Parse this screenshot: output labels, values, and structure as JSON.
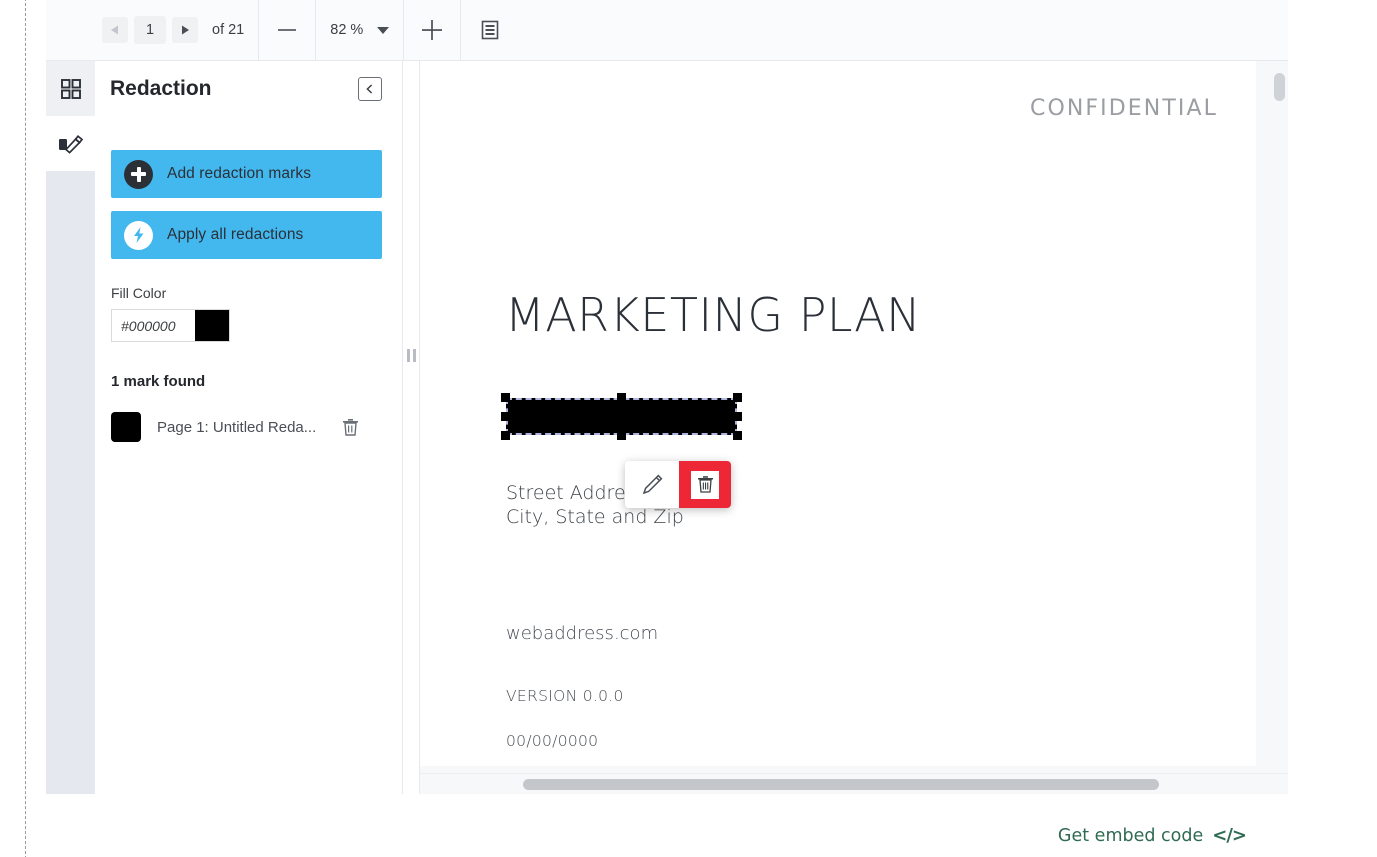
{
  "toolbar": {
    "prev_page_icon": "triangle-left-icon",
    "next_page_icon": "triangle-right-icon",
    "page_number": "1",
    "page_total_label": "of 21",
    "zoom_out_icon": "minus-icon",
    "zoom_level": "82 %",
    "zoom_dropdown_icon": "chevron-down-icon",
    "zoom_in_icon": "plus-icon",
    "page_layout_icon": "page-layout-icon"
  },
  "rail": {
    "items": [
      {
        "name": "thumbnails",
        "icon": "grid-icon"
      },
      {
        "name": "redaction",
        "icon": "pen-redact-icon"
      }
    ]
  },
  "panel": {
    "title": "Redaction",
    "collapse_icon": "chevron-left-icon",
    "add_marks_label": "Add redaction marks",
    "add_marks_icon": "plus-circle-icon",
    "apply_all_label": "Apply all redactions",
    "apply_all_icon": "bolt-circle-icon",
    "fill_color_label": "Fill Color",
    "fill_color_value": "#000000",
    "fill_color_placeholder": "#000000",
    "fill_color_swatch": "#000000",
    "marks_found_label": "1 mark found",
    "marks": [
      {
        "swatch": "#000000",
        "label": "Page 1: Untitled Reda...",
        "delete_icon": "trash-icon"
      }
    ],
    "accent_color": "#43b8ef"
  },
  "splitter": {
    "grip_icon": "drag-handle-icon"
  },
  "document": {
    "watermark": "CONFIDENTIAL",
    "title": "MARKETING PLAN",
    "address_line1": "Street Address",
    "address_line2": "City, State and Zip",
    "website": "webaddress.com",
    "version": "VERSION 0.0.0",
    "date": "00/00/0000",
    "redaction_mark": {
      "fill": "#000000",
      "selected": true
    },
    "popup": {
      "edit_icon": "pencil-icon",
      "delete_icon": "trash-icon",
      "delete_color": "#ee2737"
    }
  },
  "bottom": {
    "embed_label": "Get embed code",
    "embed_icon": "code-brackets-icon",
    "embed_color": "#2f6b52"
  }
}
